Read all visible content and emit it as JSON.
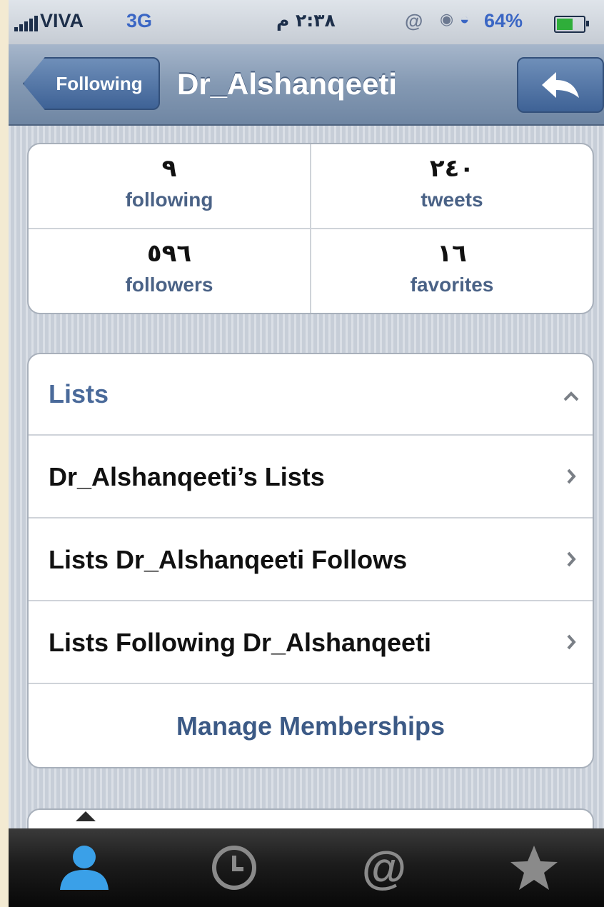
{
  "status_bar": {
    "carrier": "VIVA",
    "network": "3G",
    "time": "٢:٣٨ م",
    "battery": "64%"
  },
  "nav": {
    "back_label": "Following",
    "title": "Dr_Alshanqeeti"
  },
  "stats": {
    "following": {
      "value": "٩",
      "label": "following"
    },
    "tweets": {
      "value": "٢٤٠",
      "label": "tweets"
    },
    "followers": {
      "value": "٥٩٦",
      "label": "followers"
    },
    "favorites": {
      "value": "١٦",
      "label": "favorites"
    }
  },
  "lists": {
    "header": "Lists",
    "items": [
      {
        "label": "Dr_Alshanqeeti’s Lists"
      },
      {
        "label": "Lists Dr_Alshanqeeti Follows"
      },
      {
        "label": "Lists Following Dr_Alshanqeeti"
      }
    ],
    "manage": "Manage Memberships"
  },
  "tabbar": {
    "tabs": [
      {
        "icon": "profile-icon",
        "active": true
      },
      {
        "icon": "clock-icon",
        "active": false
      },
      {
        "icon": "at-icon",
        "active": false
      },
      {
        "icon": "star-icon",
        "active": false
      }
    ]
  },
  "colors": {
    "nav_blue": "#6f86a3",
    "link_blue": "#4a6286",
    "active_tab": "#3aa0e8"
  }
}
